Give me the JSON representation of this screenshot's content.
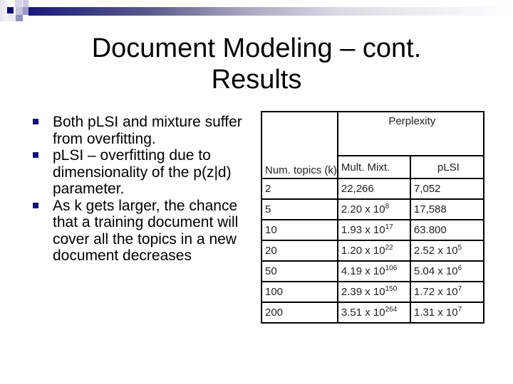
{
  "slide": {
    "title_line1": "Document Modeling – cont.",
    "title_line2": "Results",
    "bullets": [
      "Both pLSI and mixture suffer from overfitting.",
      "pLSI – overfitting due to dimensionality of the p(z|d) parameter.",
      "As k gets larger, the chance that a training document will cover all the topics in a new document decreases"
    ],
    "colors": {
      "accent": "#0f0f7a"
    }
  },
  "table": {
    "header_group": "Perplexity",
    "header_k": "Num. topics (k)",
    "header_mixt": "Mult. Mixt.",
    "header_plsi": "pLSI",
    "rows": [
      {
        "k": "2",
        "mixt": {
          "base": "22,266",
          "exp": ""
        },
        "plsi": {
          "base": "7,052",
          "exp": ""
        }
      },
      {
        "k": "5",
        "mixt": {
          "base": "2.20 x 10",
          "exp": "8"
        },
        "plsi": {
          "base": "17,588",
          "exp": ""
        }
      },
      {
        "k": "10",
        "mixt": {
          "base": "1.93 x 10",
          "exp": "17"
        },
        "plsi": {
          "base": "63.800",
          "exp": ""
        }
      },
      {
        "k": "20",
        "mixt": {
          "base": "1.20 x 10",
          "exp": "22"
        },
        "plsi": {
          "base": "2.52 x 10",
          "exp": "5"
        }
      },
      {
        "k": "50",
        "mixt": {
          "base": "4.19 x 10",
          "exp": "106"
        },
        "plsi": {
          "base": "5.04 x 10",
          "exp": "6"
        }
      },
      {
        "k": "100",
        "mixt": {
          "base": "2.39 x 10",
          "exp": "150"
        },
        "plsi": {
          "base": "1.72 x 10",
          "exp": "7"
        }
      },
      {
        "k": "200",
        "mixt": {
          "base": "3.51 x 10",
          "exp": "264"
        },
        "plsi": {
          "base": "1.31 x 10",
          "exp": "7"
        }
      }
    ]
  }
}
